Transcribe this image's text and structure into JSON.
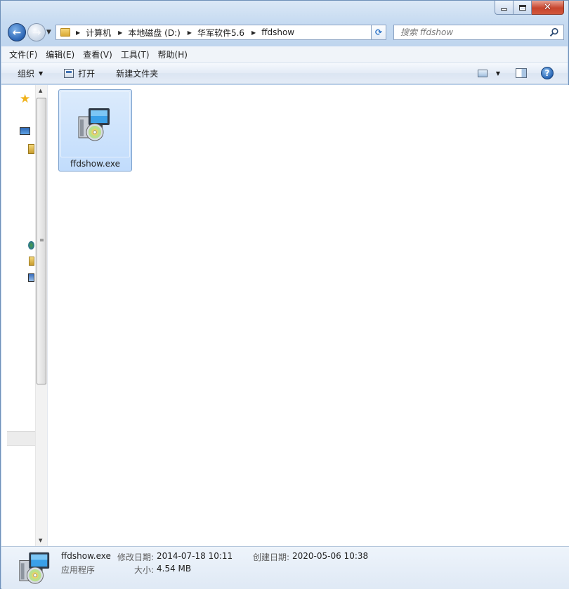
{
  "window": {
    "caption_close": "✕"
  },
  "nav": {
    "back_label": "←",
    "forward_label": "→"
  },
  "address": {
    "crumbs": [
      "计算机",
      "本地磁盘 (D:)",
      "华军软件5.6",
      "ffdshow"
    ]
  },
  "search": {
    "placeholder": "搜索 ffdshow"
  },
  "menu": {
    "items": [
      "文件(F)",
      "编辑(E)",
      "查看(V)",
      "工具(T)",
      "帮助(H)"
    ]
  },
  "commands": {
    "organize": "组织",
    "open": "打开",
    "new_folder": "新建文件夹",
    "help": "?"
  },
  "files": [
    {
      "name": "ffdshow.exe",
      "icon": "installer-icon",
      "selected": true
    }
  ],
  "details": {
    "file_name": "ffdshow.exe",
    "file_type": "应用程序",
    "modified_label": "修改日期:",
    "modified_value": "2014-07-18 10:11",
    "size_label": "大小:",
    "size_value": "4.54 MB",
    "created_label": "创建日期:",
    "created_value": "2020-05-06 10:38"
  },
  "colors": {
    "accent": "#2a64b4",
    "selection": "#c1dcfc",
    "close_button": "#c7452d"
  }
}
